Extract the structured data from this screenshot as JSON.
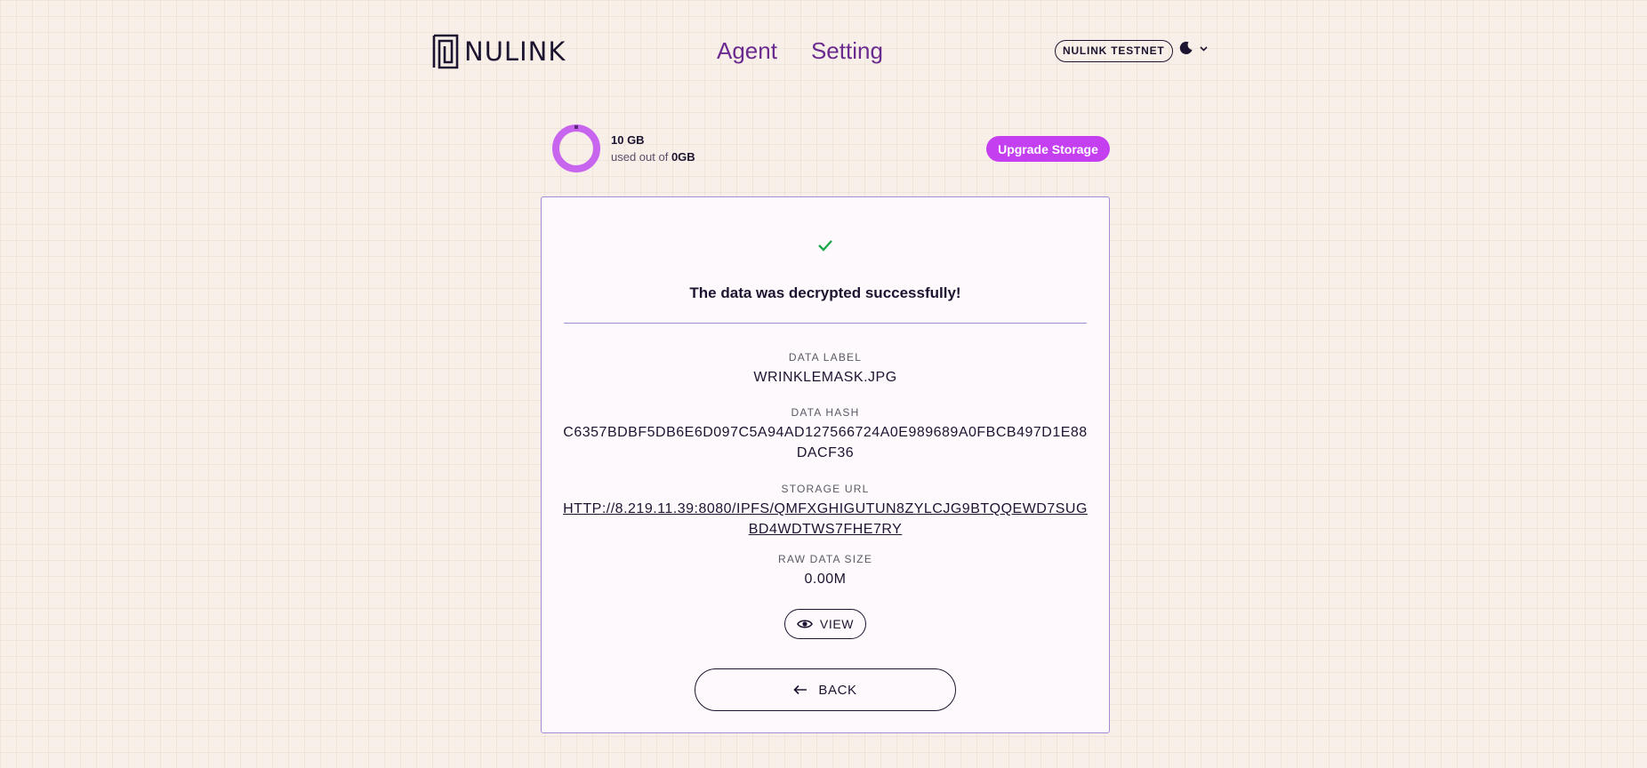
{
  "header": {
    "logo_text": "NULINK",
    "nav": [
      {
        "label": "Agent"
      },
      {
        "label": "Setting"
      }
    ],
    "network": "NULINK TESTNET",
    "theme_icon": "moon-icon"
  },
  "storage": {
    "used": "10 GB",
    "used_out_of_prefix": "used out of",
    "total": "0GB",
    "upgrade_label": "Upgrade Storage",
    "accent_color": "#c43ff0"
  },
  "result": {
    "success_message": "The data was decrypted successfully!",
    "status_icon": "check-icon",
    "status_color": "#1aa84a",
    "fields": [
      {
        "label": "DATA LABEL",
        "value": "WRINKLEMASK.JPG"
      },
      {
        "label": "DATA HASH",
        "value": "C6357BDBF5DB6E6D097C5A94AD127566724A0E989689A0FBCB497D1E88DACF36"
      },
      {
        "label": "STORAGE URL",
        "value": "HTTP://8.219.11.39:8080/IPFS/QMFXGHIGUTUN8ZYLCJG9BTQQEWD7SUGBD4WDTWS7FHE7RY"
      },
      {
        "label": "RAW DATA SIZE",
        "value": "0.00M"
      }
    ],
    "view_label": "VIEW",
    "back_label": "BACK"
  }
}
